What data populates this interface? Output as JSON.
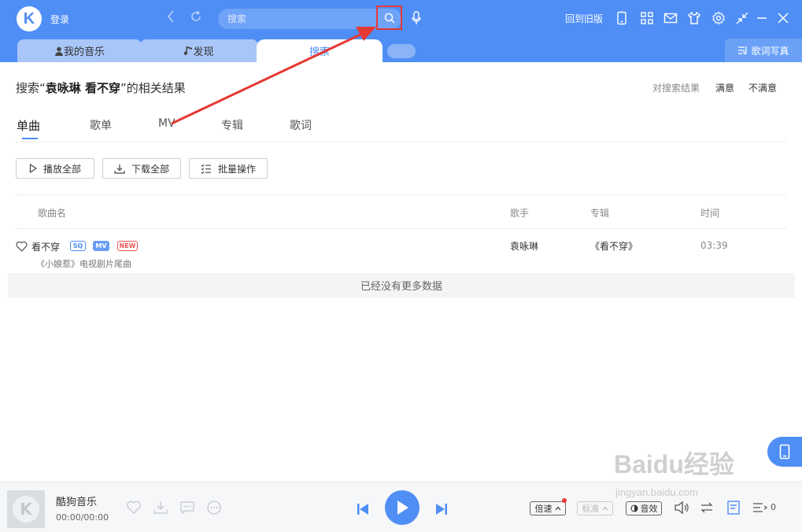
{
  "header": {
    "logo_letter": "K",
    "login_label": "登录",
    "back_icon": "chevron-left-icon",
    "refresh_icon": "refresh-icon",
    "search_placeholder": "搜索",
    "return_old_label": "回到旧版",
    "icons": [
      "phone-icon",
      "grid-icon",
      "mail-icon",
      "shirt-icon",
      "gear-icon",
      "shrink-icon",
      "minimize-icon",
      "close-icon"
    ]
  },
  "tabs": {
    "my_music": "我的音乐",
    "discover": "发现",
    "search": "搜索",
    "lyric_photo": "歌词写真"
  },
  "result": {
    "prefix": "搜索“",
    "query": "袁咏琳 看不穿",
    "suffix": "”的相关结果",
    "feedback_label": "对搜索结果",
    "satisfied": "满意",
    "unsatisfied": "不满意"
  },
  "subtabs": [
    "单曲",
    "歌单",
    "MV",
    "专辑",
    "歌词"
  ],
  "actions": {
    "play_all": "播放全部",
    "download_all": "下载全部",
    "batch": "批量操作"
  },
  "columns": {
    "name": "歌曲名",
    "artist": "歌手",
    "album": "专辑",
    "time": "时间"
  },
  "songs": [
    {
      "title": "看不穿",
      "badges": [
        "SQ",
        "MV",
        "NEW"
      ],
      "subtitle": "《小娘惹》电视剧片尾曲",
      "artist": "袁咏琳",
      "album": "《看不穿》",
      "time": "03:39"
    }
  ],
  "no_more": "已经没有更多数据",
  "player": {
    "title": "酷狗音乐",
    "time": "00:00/00:00",
    "speed_label": "倍速",
    "quality_label": "标准",
    "effect_label": "音效",
    "queue_count": "0"
  },
  "watermark": {
    "main": "Baidu经验",
    "sub": "jingyan.baidu.com"
  },
  "colors": {
    "brand": "#4f8ef5",
    "annotation": "#e53935"
  }
}
